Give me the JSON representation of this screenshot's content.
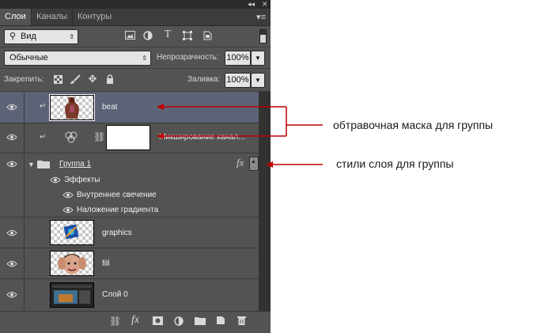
{
  "panel": {
    "top_controls": {
      "collapse": "◂◂",
      "close": "✕"
    },
    "tabs": [
      {
        "label": "Слои",
        "active": true
      },
      {
        "label": "Каналы",
        "active": false
      },
      {
        "label": "Контуры",
        "active": false
      }
    ],
    "filter": {
      "label": "Вид"
    },
    "blend": {
      "value": "Обычные"
    },
    "opacity": {
      "label": "Непрозрачность:",
      "value": "100%"
    },
    "lock": {
      "label": "Закрепить:"
    },
    "fill": {
      "label": "Заливка:",
      "value": "100%"
    },
    "layers": [
      {
        "name": "beat",
        "selected": true,
        "clipped": true
      },
      {
        "name": "Микширование канал...",
        "adjustment": true,
        "clipped": true
      },
      {
        "name": "Группа 1",
        "group": true,
        "expanded": true,
        "fx": "fx",
        "effects_label": "Эффекты",
        "effects": [
          "Внутреннее свечение",
          "Наложение градиента"
        ]
      },
      {
        "name": "graphics"
      },
      {
        "name": "fill"
      },
      {
        "name": "Слой 0"
      }
    ],
    "bottom_bar": {
      "fx": "fx"
    }
  },
  "annotations": {
    "clip_mask": "обтравочная маска для группы",
    "layer_styles": "стили слоя для группы"
  },
  "colors": {
    "panel_bg": "#535353",
    "selected_row": "#5d6376",
    "annotation_arrow": "#c00000"
  }
}
